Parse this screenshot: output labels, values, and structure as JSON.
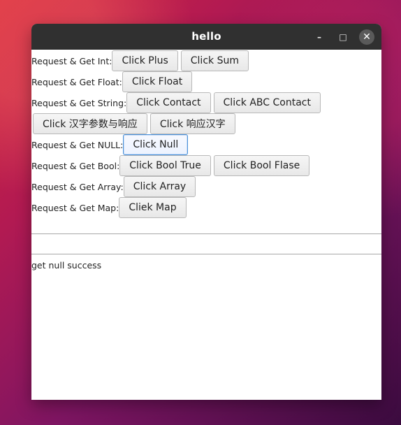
{
  "window": {
    "title": "hello",
    "controls": {
      "minimize": "–",
      "maximize": "□",
      "close": "✕"
    }
  },
  "rows": [
    {
      "label": "Request & Get Int:",
      "buttons": [
        {
          "label": "Click Plus",
          "name": "click-plus-button"
        },
        {
          "label": "Click Sum",
          "name": "click-sum-button"
        }
      ]
    },
    {
      "label": "Request & Get Float:",
      "buttons": [
        {
          "label": "Click Float",
          "name": "click-float-button"
        }
      ]
    },
    {
      "label": "Request & Get String:",
      "buttons": [
        {
          "label": "Click Contact",
          "name": "click-contact-button"
        },
        {
          "label": "Click ABC Contact",
          "name": "click-abc-contact-button"
        }
      ]
    },
    {
      "label": "",
      "buttons": [
        {
          "label": "Click 汉字参数与响应",
          "name": "click-chinese-params-response-button"
        },
        {
          "label": "Click 响应汉字",
          "name": "click-response-chinese-button"
        }
      ]
    },
    {
      "label": "Request & Get NULL:",
      "buttons": [
        {
          "label": "Click Null",
          "name": "click-null-button",
          "focused": true
        }
      ]
    },
    {
      "label": "Request & Get Bool:",
      "buttons": [
        {
          "label": "Click Bool True",
          "name": "click-bool-true-button"
        },
        {
          "label": "Click Bool Flase",
          "name": "click-bool-flase-button"
        }
      ]
    },
    {
      "label": "Request & Get Array:",
      "buttons": [
        {
          "label": "Click Array",
          "name": "click-array-button"
        }
      ]
    },
    {
      "label": "Request & Get Map:",
      "buttons": [
        {
          "label": "Cliek Map",
          "name": "cliek-map-button"
        }
      ]
    }
  ],
  "status": {
    "message": "get null success"
  }
}
